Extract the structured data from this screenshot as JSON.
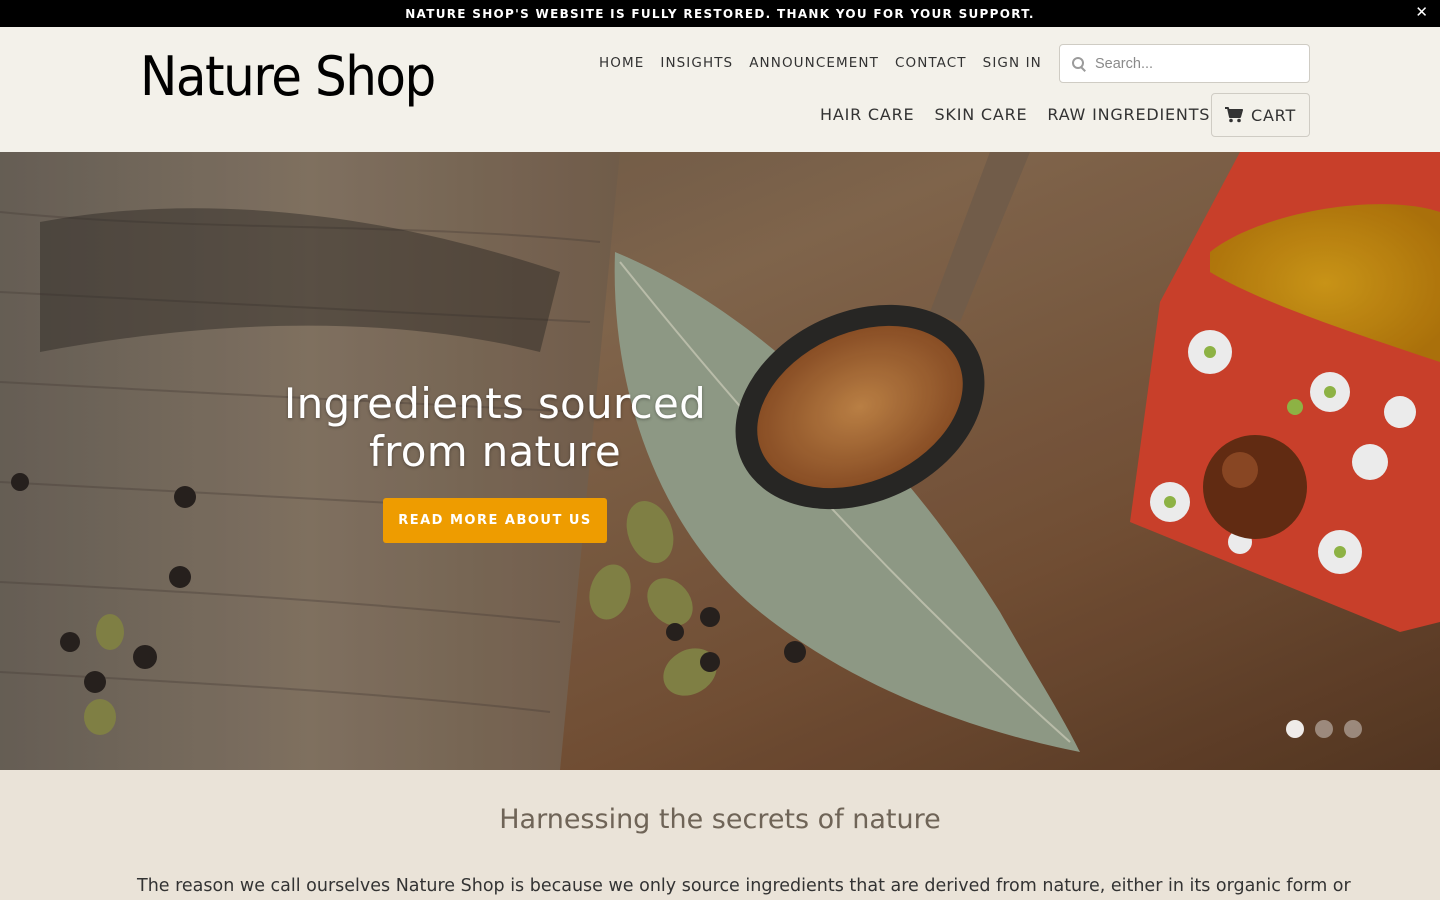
{
  "announcement": {
    "text": "NATURE SHOP'S WEBSITE IS FULLY RESTORED. THANK YOU FOR YOUR SUPPORT.",
    "close_icon": "close-icon",
    "close_glyph": "✕"
  },
  "header": {
    "logo_text": "Nature Shop",
    "nav_top": [
      "HOME",
      "INSIGHTS",
      "ANNOUNCEMENT",
      "CONTACT",
      "SIGN IN"
    ],
    "search": {
      "placeholder": "Search...",
      "value": ""
    },
    "nav_bottom": [
      "HAIR CARE",
      "SKIN CARE",
      "RAW INGREDIENTS"
    ],
    "cart_label": "CART"
  },
  "hero": {
    "title": "Ingredients sourced from nature",
    "button_label": "READ MORE ABOUT US",
    "slides": 3,
    "active_slide": 1,
    "button_color": "#ee9c00"
  },
  "intro": {
    "title": "Harnessing the secrets of nature",
    "body": "The reason we call ourselves Nature Shop is because we only source ingredients that are derived from nature, either in its organic form or"
  },
  "colors": {
    "announcement_bg": "#000000",
    "header_bg": "#f3f1ea",
    "page_bg": "#eae3d8",
    "accent": "#ee9c00"
  }
}
